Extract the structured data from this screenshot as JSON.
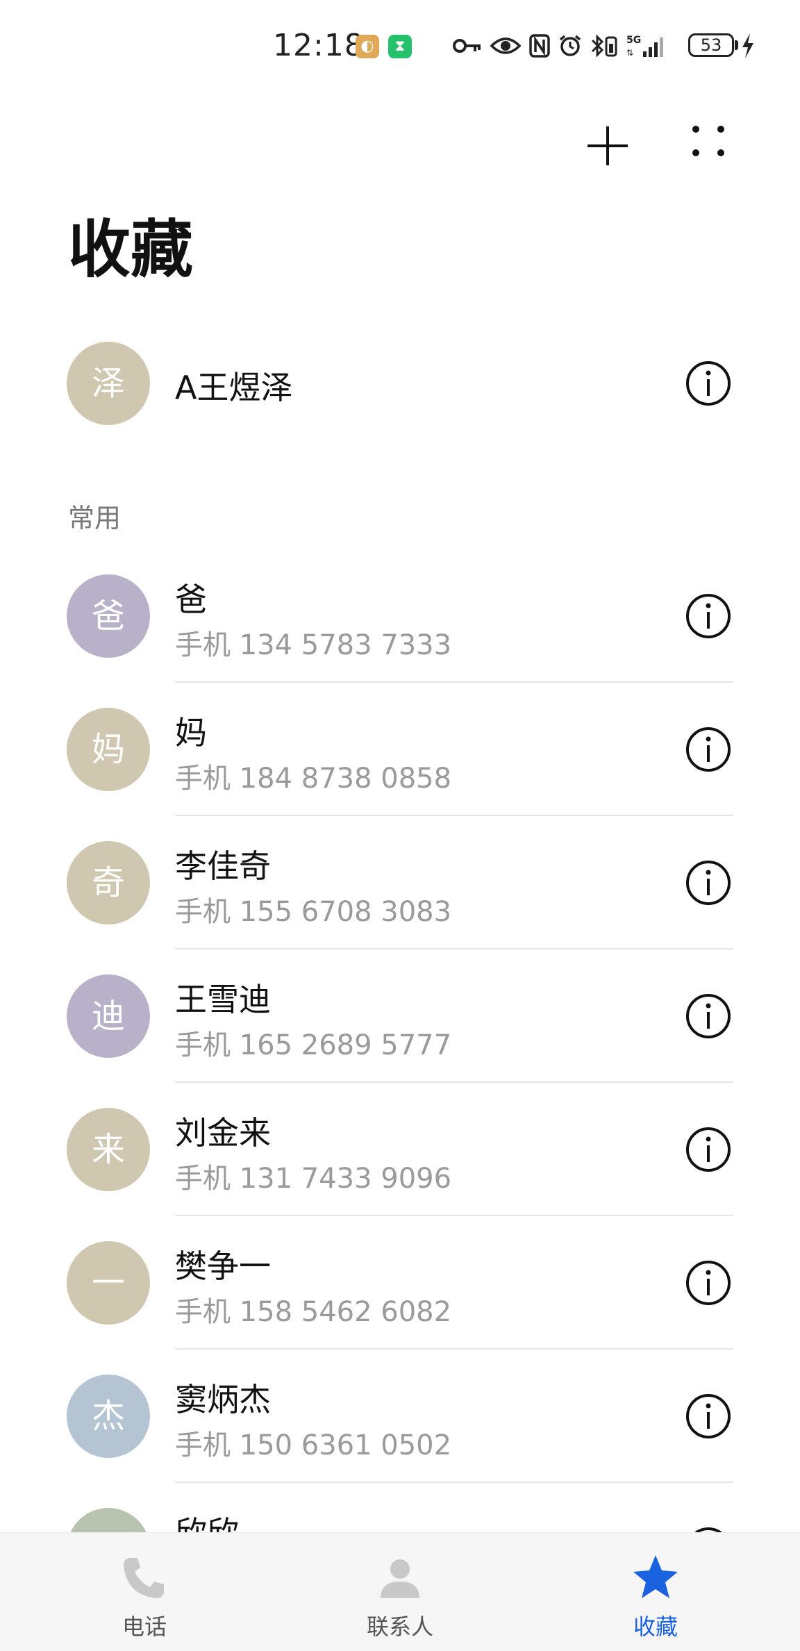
{
  "status_bar": {
    "time": "12:18",
    "network": "5G",
    "battery": "53"
  },
  "toolbar": {
    "add_icon": "plus-icon",
    "more_icon": "more-dots-icon"
  },
  "page": {
    "title": "收藏"
  },
  "favorite": {
    "avatar": "泽",
    "avatar_color": "#cfc7b0",
    "name": "A王煜泽"
  },
  "section": {
    "header": "常用"
  },
  "contacts": [
    {
      "avatar": "爸",
      "avatar_color": "#b9b1c9",
      "name": "爸",
      "phone": "手机 134 5783 7333"
    },
    {
      "avatar": "妈",
      "avatar_color": "#cfc7b0",
      "name": "妈",
      "phone": "手机 184 8738 0858"
    },
    {
      "avatar": "奇",
      "avatar_color": "#cfc7b0",
      "name": "李佳奇",
      "phone": "手机 155 6708 3083"
    },
    {
      "avatar": "迪",
      "avatar_color": "#b9b1c9",
      "name": "王雪迪",
      "phone": "手机 165 2689 5777"
    },
    {
      "avatar": "来",
      "avatar_color": "#cfc7b0",
      "name": "刘金来",
      "phone": "手机 131 7433 9096"
    },
    {
      "avatar": "一",
      "avatar_color": "#cfc7b0",
      "name": "樊争一",
      "phone": "手机 158 5462 6082"
    },
    {
      "avatar": "杰",
      "avatar_color": "#b5c4d3",
      "name": "窦炳杰",
      "phone": "手机 150 6361 0502"
    },
    {
      "avatar": "",
      "avatar_color": "#b8c4b0",
      "name": "欣欣",
      "phone": ""
    }
  ],
  "bottom_nav": {
    "items": [
      {
        "label": "电话",
        "icon": "phone-icon"
      },
      {
        "label": "联系人",
        "icon": "person-icon"
      },
      {
        "label": "收藏",
        "icon": "star-icon"
      }
    ],
    "active_color": "#1a63e0",
    "inactive_color": "#c8c8c8"
  }
}
